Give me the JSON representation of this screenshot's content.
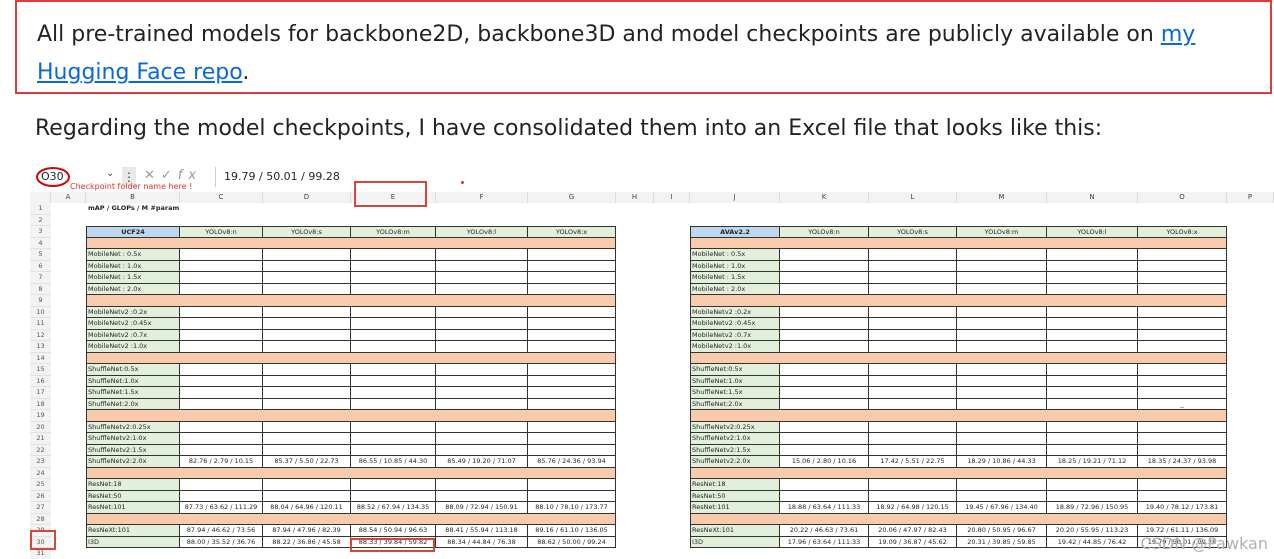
{
  "notice": {
    "text_before": "All pre-trained models for backbone2D, backbone3D and model checkpoints are publicly available on ",
    "link_text": "my Hugging Face repo",
    "text_after": ".",
    "border_color": "#e03a3a",
    "link_color": "#0969da"
  },
  "paragraph": "Regarding the model checkpoints, I have consolidated them into an Excel file that looks like this:",
  "spreadsheet": {
    "name_box": "O30",
    "formula_value": "19.79 / 50.01 / 99.28",
    "annotation": "Checkpoint folder name here !",
    "fx_icon": "fx-icon",
    "columns": [
      "A",
      "B",
      "C",
      "D",
      "E",
      "F",
      "G",
      "H",
      "I",
      "J",
      "K",
      "L",
      "M",
      "N",
      "O",
      "P"
    ],
    "row_numbers": [
      "1",
      "2",
      "3",
      "4",
      "5",
      "6",
      "7",
      "8",
      "9",
      "10",
      "11",
      "12",
      "13",
      "14",
      "15",
      "16",
      "17",
      "18",
      "19",
      "20",
      "21",
      "22",
      "23",
      "24",
      "25",
      "26",
      "27",
      "28",
      "29",
      "30",
      "31"
    ],
    "title_cell": "mAP / GLOPs / M #param",
    "left_table": {
      "dataset": "UCF24",
      "headers": [
        "YOLOv8:n",
        "YOLOv8:s",
        "YOLOv8:m",
        "YOLOv8:l",
        "YOLOv8:x"
      ],
      "rows": [
        {
          "label": "",
          "group": true
        },
        {
          "label": "MobileNet : 0.5x",
          "v": [
            "",
            "",
            "",
            "",
            ""
          ]
        },
        {
          "label": "MobileNet : 1.0x",
          "v": [
            "",
            "",
            "",
            "",
            ""
          ]
        },
        {
          "label": "MobileNet : 1.5x",
          "v": [
            "",
            "",
            "",
            "",
            ""
          ]
        },
        {
          "label": "MobileNet : 2.0x",
          "v": [
            "",
            "",
            "",
            "",
            ""
          ]
        },
        {
          "label": "",
          "group": true
        },
        {
          "label": "MobileNetv2 :0.2x",
          "v": [
            "",
            "",
            "",
            "",
            ""
          ]
        },
        {
          "label": "MobileNetv2 :0.45x",
          "v": [
            "",
            "",
            "",
            "",
            ""
          ]
        },
        {
          "label": "MobileNetv2 :0.7x",
          "v": [
            "",
            "",
            "",
            "",
            ""
          ]
        },
        {
          "label": "MobileNetv2 :1.0x",
          "v": [
            "",
            "",
            "",
            "",
            ""
          ]
        },
        {
          "label": "",
          "group": true
        },
        {
          "label": "ShuffleNet:0.5x",
          "v": [
            "",
            "",
            "",
            "",
            ""
          ]
        },
        {
          "label": "ShuffleNet:1.0x",
          "v": [
            "",
            "",
            "",
            "",
            ""
          ]
        },
        {
          "label": "ShuffleNet:1.5x",
          "v": [
            "",
            "",
            "",
            "",
            ""
          ]
        },
        {
          "label": "ShuffleNet:2.0x",
          "v": [
            "",
            "",
            "",
            "",
            ""
          ]
        },
        {
          "label": "",
          "group": true
        },
        {
          "label": "ShuffleNetv2:0.25x",
          "v": [
            "",
            "",
            "",
            "",
            ""
          ]
        },
        {
          "label": "ShuffleNetv2:1.0x",
          "v": [
            "",
            "",
            "",
            "",
            ""
          ]
        },
        {
          "label": "ShuffleNetv2:1.5x",
          "v": [
            "",
            "",
            "",
            "",
            ""
          ]
        },
        {
          "label": "ShuffleNetv2:2.0x",
          "v": [
            "82.76 / 2.79 / 10.15",
            "85.37 / 5.50 / 22.73",
            "86.55 / 10.85 / 44.30",
            "85.49 / 19.20 / 71.07",
            "85.76 / 24.36 / 93.94"
          ]
        },
        {
          "label": "",
          "group": true
        },
        {
          "label": "ResNet:18",
          "v": [
            "",
            "",
            "",
            "",
            ""
          ]
        },
        {
          "label": "ResNet:50",
          "v": [
            "",
            "",
            "",
            "",
            ""
          ]
        },
        {
          "label": "ResNet:101",
          "v": [
            "87.73 / 63.62 / 111.29",
            "88.04 / 64.96 / 120.11",
            "88.52 / 67.94 / 134.35",
            "88.09 / 72.94 / 150.91",
            "88.10 / 78.10 / 173.77"
          ]
        },
        {
          "label": "",
          "group": true
        },
        {
          "label": "ResNeXt:101",
          "v": [
            "87.94 / 46.62 / 73.56",
            "87.94 / 47.96 / 82.39",
            "88.54 / 50.94 / 96.63",
            "88.41 / 55.94 / 113.18",
            "89.16 / 61.10 / 136.05"
          ]
        },
        {
          "label": "I3D",
          "v": [
            "88.00 / 35.52 / 36.76",
            "88.22 / 36.86 / 45.58",
            "88.33 / 39.84 / 59.82",
            "88.34 / 44.84 / 76.38",
            "88.62 / 50.00 / 99.24"
          ]
        }
      ]
    },
    "right_table": {
      "dataset": "AVAv2.2",
      "headers": [
        "YOLOv8:n",
        "YOLOv8:s",
        "YOLOv8:m",
        "YOLOv8:l",
        "YOLOv8:x"
      ],
      "rows": [
        {
          "label": "",
          "group": true
        },
        {
          "label": "MobileNet : 0.5x",
          "v": [
            "",
            "",
            "",
            "",
            ""
          ]
        },
        {
          "label": "MobileNet : 1.0x",
          "v": [
            "",
            "",
            "",
            "",
            ""
          ]
        },
        {
          "label": "MobileNet : 1.5x",
          "v": [
            "",
            "",
            "",
            "",
            ""
          ]
        },
        {
          "label": "MobileNet : 2.0x",
          "v": [
            "",
            "",
            "",
            "",
            ""
          ]
        },
        {
          "label": "",
          "group": true
        },
        {
          "label": "MobileNetv2 :0.2x",
          "v": [
            "",
            "",
            "",
            "",
            ""
          ]
        },
        {
          "label": "MobileNetv2 :0.45x",
          "v": [
            "",
            "",
            "",
            "",
            ""
          ]
        },
        {
          "label": "MobileNetv2 :0.7x",
          "v": [
            "",
            "",
            "",
            "",
            ""
          ]
        },
        {
          "label": "MobileNetv2 :1.0x",
          "v": [
            "",
            "",
            "",
            "",
            ""
          ]
        },
        {
          "label": "",
          "group": true
        },
        {
          "label": "ShuffleNet:0.5x",
          "v": [
            "",
            "",
            "",
            "",
            ""
          ]
        },
        {
          "label": "ShuffleNet:1.0x",
          "v": [
            "",
            "",
            "",
            "",
            ""
          ]
        },
        {
          "label": "ShuffleNet:1.5x",
          "v": [
            "",
            "",
            "",
            "",
            ""
          ]
        },
        {
          "label": "ShuffleNet:2.0x",
          "v": [
            "",
            "",
            "",
            "",
            "_"
          ]
        },
        {
          "label": "",
          "group": true
        },
        {
          "label": "ShuffleNetv2:0.25x",
          "v": [
            "",
            "",
            "",
            "",
            ""
          ]
        },
        {
          "label": "ShuffleNetv2:1.0x",
          "v": [
            "",
            "",
            "",
            "",
            ""
          ]
        },
        {
          "label": "ShuffleNetv2:1.5x",
          "v": [
            "",
            "",
            "",
            "",
            ""
          ]
        },
        {
          "label": "ShuffleNetv2:2.0x",
          "v": [
            "15.06 / 2.80 / 10.16",
            "17.42 / 5.51 / 22.75",
            "18.29 / 10.86 / 44.33",
            "18.25 / 19.21 / 71.12",
            "18.35 / 24.37 / 93.98"
          ]
        },
        {
          "label": "",
          "group": true
        },
        {
          "label": "ResNet:18",
          "v": [
            "",
            "",
            "",
            "",
            ""
          ]
        },
        {
          "label": "ResNet:50",
          "v": [
            "",
            "",
            "",
            "",
            ""
          ]
        },
        {
          "label": "ResNet:101",
          "v": [
            "18.88 / 63.64 / 111.33",
            "18.92 / 64.98 / 120.15",
            "19.45 / 67.96 / 134.40",
            "18.89 / 72.96 / 150.95",
            "19.40 / 78.12 / 173.81"
          ]
        },
        {
          "label": "",
          "group": true
        },
        {
          "label": "ResNeXt:101",
          "v": [
            "20.22 / 46.63 / 73.61",
            "20.06 / 47.97 / 82.43",
            "20.80 / 50.95 / 96.67",
            "20.20 / 55.95 / 113.23",
            "19.72 / 61.11 / 136.09"
          ]
        },
        {
          "label": "I3D",
          "v": [
            "17.96 / 63.64 / 111.33",
            "19.09 / 36.87 / 45.62",
            "20.31 / 39.85 / 59.85",
            "19.42 / 44.85 / 76.42",
            "19.79 / 50.01 / 99.28"
          ]
        }
      ]
    },
    "colors": {
      "header_blue": "#bdd7ee",
      "header_green": "#e2efda",
      "label_green": "#e2efda",
      "group_peach": "#f8cbad"
    },
    "watermark": "CSDN @Pawkan"
  }
}
